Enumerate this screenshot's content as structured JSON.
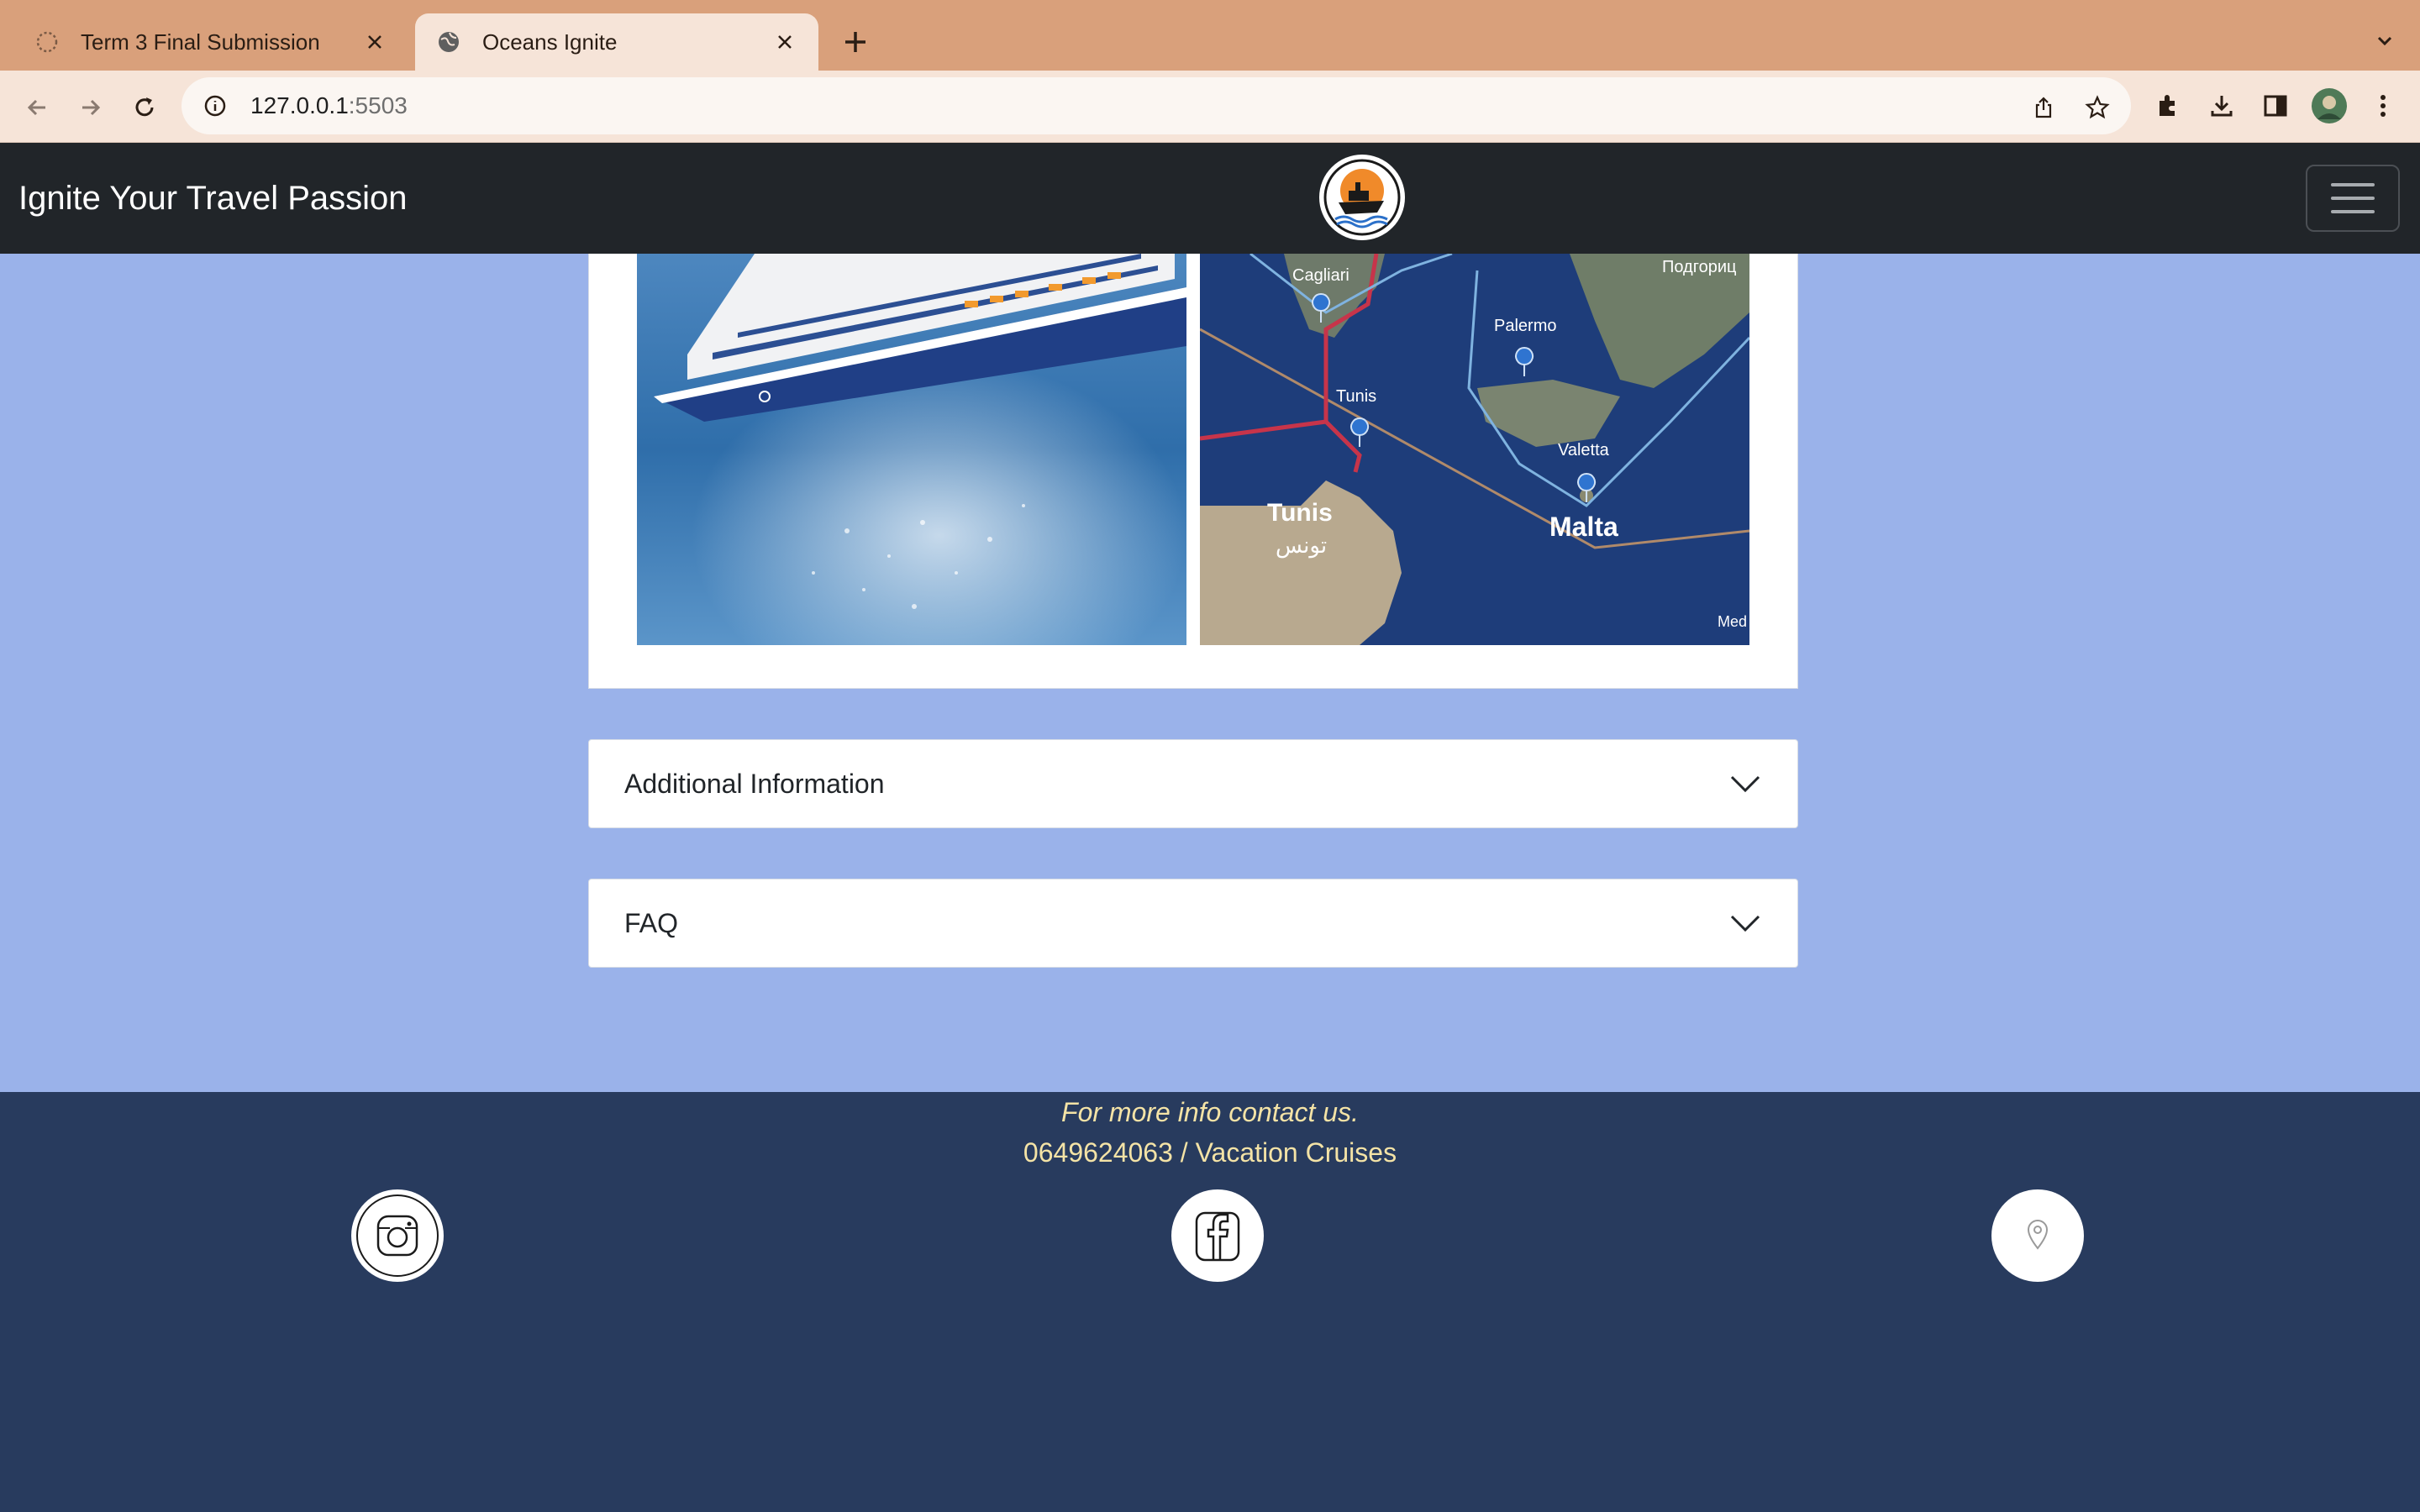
{
  "browser": {
    "tabs": [
      {
        "title": "Term 3 Final Submission",
        "active": false,
        "icon": "loading-spinner-icon"
      },
      {
        "title": "Oceans Ignite",
        "active": true,
        "icon": "globe-icon"
      }
    ],
    "url_host": "127.0.0.1",
    "url_port": ":5503"
  },
  "navbar": {
    "brand": "Ignite Your Travel Passion",
    "logo_icon": "cruise-ship-logo-icon",
    "menu_icon": "hamburger-icon"
  },
  "gallery": {
    "images": [
      {
        "alt": "Cruise ship at sea"
      },
      {
        "alt": "Mediterranean route map"
      }
    ],
    "map_labels": [
      "Cagliari",
      "Подгориц",
      "Palermo",
      "Tunis",
      "Valetta",
      "Tunis",
      "تونس",
      "Malta",
      "Med"
    ]
  },
  "accordions": [
    {
      "label": "Additional Information"
    },
    {
      "label": "FAQ"
    }
  ],
  "footer": {
    "tagline": "For more info contact us.",
    "contact": "0649624063 / Vacation Cruises",
    "social": [
      "instagram-icon",
      "facebook-icon",
      "location-pin-icon"
    ]
  },
  "colors": {
    "tabbar": "#d9a07b",
    "toolbar": "#f6e4d8",
    "navbar": "#212529",
    "page_bg": "#9ab2ea",
    "footer_bg": "#283b5e",
    "footer_text": "#f4e3a6"
  }
}
